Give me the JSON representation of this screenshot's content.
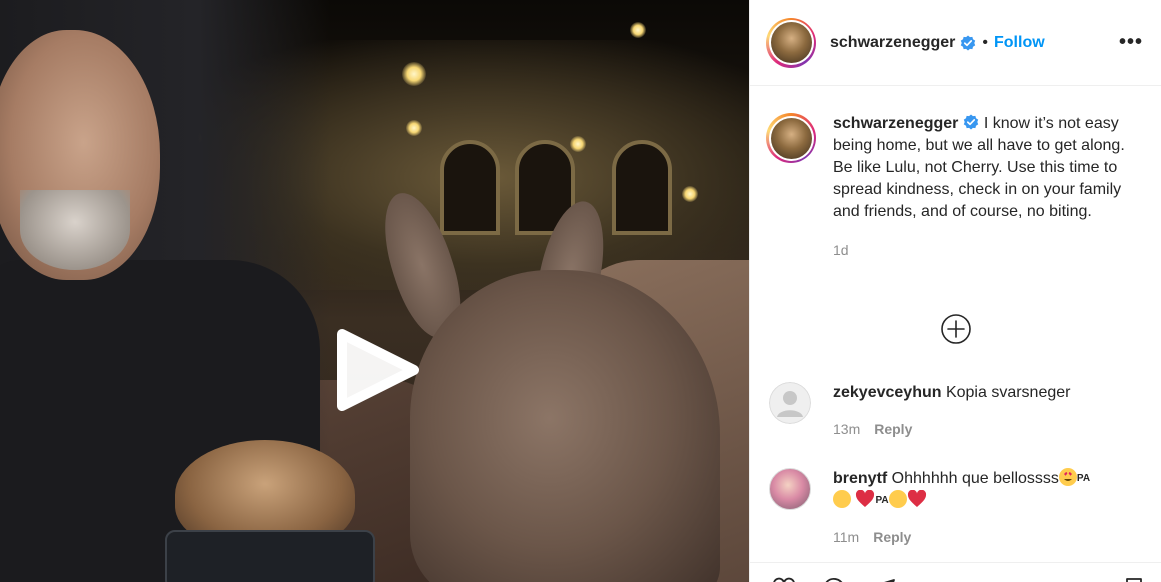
{
  "post": {
    "username": "schwarzenegger",
    "follow_label": "Follow",
    "separator": "•",
    "more_label": "•••"
  },
  "caption": {
    "username": "schwarzenegger",
    "text": " I know it’s not easy being home, but we all have to get along. Be like Lulu, not Cherry. Use this time to spread kindness, check in on your family and friends, and of course, no biting.",
    "time": "1d"
  },
  "comments": [
    {
      "username": "zekyevceyhun",
      "text": " Kopia svarsneger",
      "time": "13m",
      "reply_label": "Reply"
    },
    {
      "username": "brenytf",
      "text": " Ohhhhhh que bellossss",
      "tag1": "PA",
      "tag2": "PA",
      "time": "11m",
      "reply_label": "Reply"
    }
  ],
  "colors": {
    "accent": "#0095f6",
    "verified": "#3897f0",
    "secondary_text": "#8e8e8e",
    "heart": "#ed4956"
  },
  "icons": {
    "play": "play-icon",
    "verified": "verified-badge-icon",
    "load_more": "plus-circle-icon",
    "more": "more-options-icon"
  }
}
